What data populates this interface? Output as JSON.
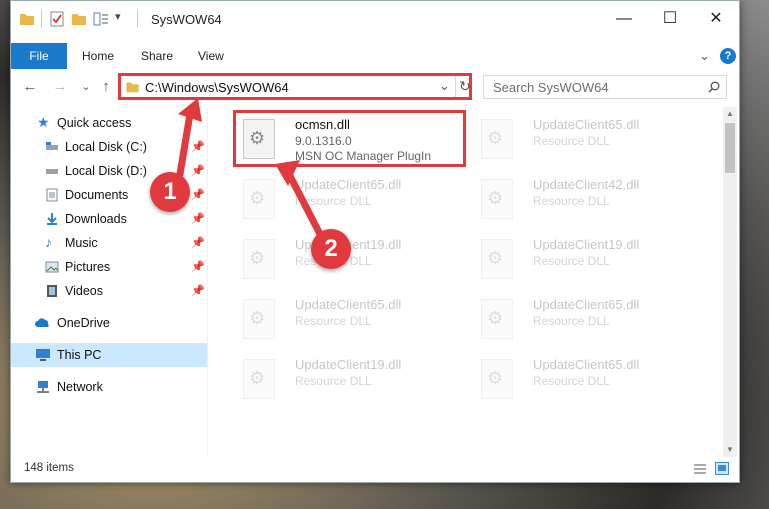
{
  "window": {
    "title": "SysWOW64",
    "minimize_glyph": "—",
    "maximize_glyph": "☐",
    "close_glyph": "✕"
  },
  "ribbon": {
    "tabs": [
      "File",
      "Home",
      "Share",
      "View"
    ],
    "chevron": "⌄",
    "help": "?"
  },
  "nav": {
    "back": "←",
    "forward": "→",
    "recent": "⌄",
    "up": "↑"
  },
  "address": {
    "path": "C:\\Windows\\SysWOW64",
    "dropdown": "⌄",
    "refresh": "↻"
  },
  "search": {
    "placeholder": "Search SysWOW64"
  },
  "sidebar": {
    "items": [
      {
        "label": "Quick access",
        "icon": "star-icon"
      },
      {
        "label": "Local Disk (C:)",
        "icon": "drive-icon",
        "pinned": true
      },
      {
        "label": "Local Disk (D:)",
        "icon": "drive-icon",
        "pinned": true
      },
      {
        "label": "Documents",
        "icon": "documents-icon",
        "pinned": true
      },
      {
        "label": "Downloads",
        "icon": "download-icon",
        "pinned": true
      },
      {
        "label": "Music",
        "icon": "music-icon",
        "pinned": true
      },
      {
        "label": "Pictures",
        "icon": "pictures-icon",
        "pinned": true
      },
      {
        "label": "Videos",
        "icon": "video-icon",
        "pinned": true
      },
      {
        "label": "OneDrive",
        "icon": "cloud-icon"
      },
      {
        "label": "This PC",
        "icon": "computer-icon",
        "selected": true
      },
      {
        "label": "Network",
        "icon": "network-icon"
      }
    ]
  },
  "files": {
    "highlighted": {
      "name": "ocmsn.dll",
      "version": "9.0.1316.0",
      "description": "MSN OC Manager PlugIn"
    },
    "faded": [
      {
        "name": "UpdateClient65.dll",
        "type": "Resource DLL"
      },
      {
        "name": "UpdateClient65.dll",
        "type": "Resource DLL"
      },
      {
        "name": "UpdateClient42.dll",
        "type": "Resource DLL"
      },
      {
        "name": "UpdateClient19.dll",
        "type": "Resource DLL"
      },
      {
        "name": "UpdateClient19.dll",
        "type": "Resource DLL"
      },
      {
        "name": "UpdateClient65.dll",
        "type": "Resource DLL"
      },
      {
        "name": "UpdateClient65.dll",
        "type": "Resource DLL"
      },
      {
        "name": "UpdateClient19.dll",
        "type": "Resource DLL"
      },
      {
        "name": "UpdateClient65.dll",
        "type": "Resource DLL"
      }
    ]
  },
  "status": {
    "count": "148 items"
  },
  "callouts": [
    "1",
    "2"
  ],
  "colors": {
    "accent": "#1979ca",
    "annotation_red": "#e0393e",
    "selection": "#cce8ff"
  }
}
